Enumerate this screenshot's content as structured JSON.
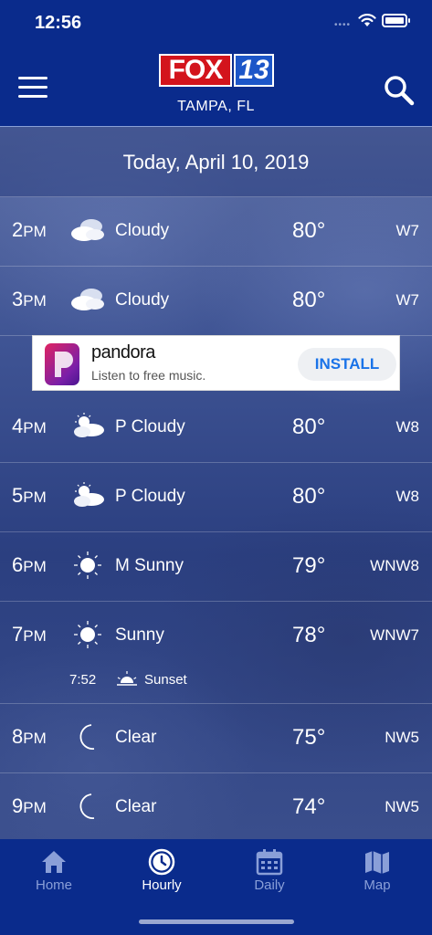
{
  "status_bar": {
    "time": "12:56"
  },
  "header": {
    "logo_left": "FOX",
    "logo_right": "13",
    "city": "TAMPA, FL"
  },
  "date_header": "Today, April 10, 2019",
  "hours": [
    {
      "hour": "2",
      "ampm": "PM",
      "icon": "cloudy-icon",
      "condition": "Cloudy",
      "temp": "80°",
      "wind": "W7"
    },
    {
      "hour": "3",
      "ampm": "PM",
      "icon": "cloudy-icon",
      "condition": "Cloudy",
      "temp": "80°",
      "wind": "W7"
    },
    {
      "hour": "4",
      "ampm": "PM",
      "icon": "partly-cloudy-icon",
      "condition": "P Cloudy",
      "temp": "80°",
      "wind": "W8"
    },
    {
      "hour": "5",
      "ampm": "PM",
      "icon": "partly-cloudy-icon",
      "condition": "P Cloudy",
      "temp": "80°",
      "wind": "W8"
    },
    {
      "hour": "6",
      "ampm": "PM",
      "icon": "sun-icon",
      "condition": "M Sunny",
      "temp": "79°",
      "wind": "WNW8"
    },
    {
      "hour": "7",
      "ampm": "PM",
      "icon": "sun-icon",
      "condition": "Sunny",
      "temp": "78°",
      "wind": "WNW7"
    },
    {
      "hour": "8",
      "ampm": "PM",
      "icon": "moon-icon",
      "condition": "Clear",
      "temp": "75°",
      "wind": "NW5"
    },
    {
      "hour": "9",
      "ampm": "PM",
      "icon": "moon-icon",
      "condition": "Clear",
      "temp": "74°",
      "wind": "NW5"
    }
  ],
  "sunset": {
    "time": "7:52",
    "label": "Sunset",
    "icon": "sunset-icon"
  },
  "ad": {
    "brand": "pandora",
    "subtitle": "Listen to free music.",
    "button": "INSTALL"
  },
  "tabs": [
    {
      "label": "Home",
      "icon": "home-icon",
      "active": false
    },
    {
      "label": "Hourly",
      "icon": "clock-icon",
      "active": true
    },
    {
      "label": "Daily",
      "icon": "calendar-icon",
      "active": false
    },
    {
      "label": "Map",
      "icon": "map-icon",
      "active": false
    }
  ],
  "colors": {
    "header_bg": "#0a2b8c",
    "accent_red": "#d3141c",
    "install_blue": "#1a73e8",
    "tab_inactive": "#8a9fd8"
  }
}
